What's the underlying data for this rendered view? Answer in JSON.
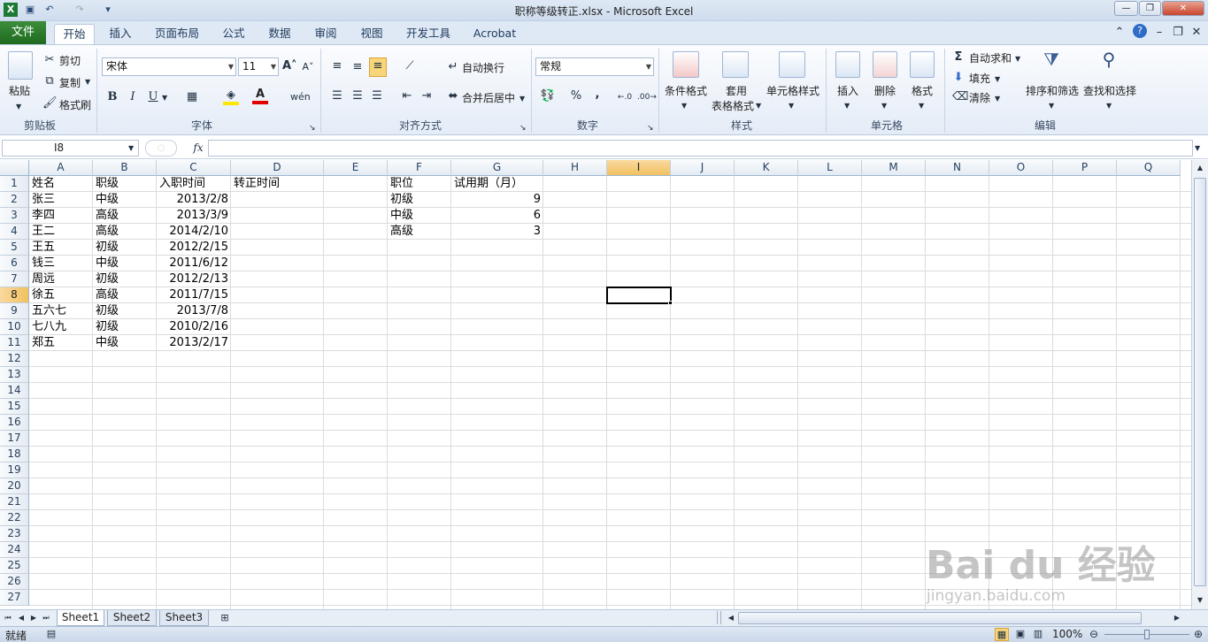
{
  "window": {
    "title": "职称等级转正.xlsx - Microsoft Excel"
  },
  "tabs": [
    "文件",
    "开始",
    "插入",
    "页面布局",
    "公式",
    "数据",
    "审阅",
    "视图",
    "开发工具",
    "Acrobat"
  ],
  "ribbon": {
    "clipboard": {
      "paste": "粘贴",
      "cut": "剪切",
      "copy": "复制",
      "format_painter": "格式刷",
      "label": "剪贴板"
    },
    "font": {
      "name": "宋体",
      "size": "11",
      "label": "字体",
      "bold": "B",
      "italic": "I",
      "underline": "U"
    },
    "alignment": {
      "wrap": "自动换行",
      "merge": "合并后居中",
      "label": "对齐方式"
    },
    "number": {
      "format": "常规",
      "label": "数字",
      "percent": "%",
      "comma": ","
    },
    "styles": {
      "conditional": "条件格式",
      "table_line1": "套用",
      "table_line2": "表格格式",
      "cell_styles": "单元格样式",
      "label": "样式"
    },
    "cells": {
      "insert": "插入",
      "delete": "删除",
      "format": "格式",
      "label": "单元格"
    },
    "editing": {
      "autosum": "自动求和",
      "fill": "填充",
      "clear": "清除",
      "sort": "排序和筛选",
      "find": "查找和选择",
      "label": "编辑"
    }
  },
  "formula_bar": {
    "name_box": "I8",
    "fx": "fx",
    "value": ""
  },
  "columns": [
    "A",
    "B",
    "C",
    "D",
    "E",
    "F",
    "G",
    "H",
    "I",
    "J",
    "K",
    "L",
    "M",
    "N",
    "O",
    "P",
    "Q"
  ],
  "rows": [
    "1",
    "2",
    "3",
    "4",
    "5",
    "6",
    "7",
    "8",
    "9",
    "10",
    "11",
    "12",
    "13",
    "14",
    "15",
    "16",
    "17",
    "18",
    "19",
    "20",
    "21",
    "22",
    "23",
    "24",
    "25",
    "26",
    "27"
  ],
  "selected_cell": "I8",
  "cells": {
    "A1": "姓名",
    "B1": "职级",
    "C1": "入职时间",
    "D1": "转正时间",
    "F1": "职位",
    "G1": "试用期（月）",
    "A2": "张三",
    "B2": "中级",
    "C2": "2013/2/8",
    "F2": "初级",
    "G2": "9",
    "A3": "李四",
    "B3": "高级",
    "C3": "2013/3/9",
    "F3": "中级",
    "G3": "6",
    "A4": "王二",
    "B4": "高级",
    "C4": "2014/2/10",
    "F4": "高级",
    "G4": "3",
    "A5": "王五",
    "B5": "初级",
    "C5": "2012/2/15",
    "A6": "钱三",
    "B6": "中级",
    "C6": "2011/6/12",
    "A7": "周远",
    "B7": "初级",
    "C7": "2012/2/13",
    "A8": "徐五",
    "B8": "高级",
    "C8": "2011/7/15",
    "A9": "五六七",
    "B9": "初级",
    "C9": "2013/7/8",
    "A10": "七八九",
    "B10": "初级",
    "C10": "2010/2/16",
    "A11": "郑五",
    "B11": "中级",
    "C11": "2013/2/17"
  },
  "sheets": [
    "Sheet1",
    "Sheet2",
    "Sheet3"
  ],
  "status": {
    "ready": "就绪",
    "zoom": "100%"
  },
  "watermark": {
    "brand": "Bai du 经验",
    "url": "jingyan.baidu.com"
  }
}
